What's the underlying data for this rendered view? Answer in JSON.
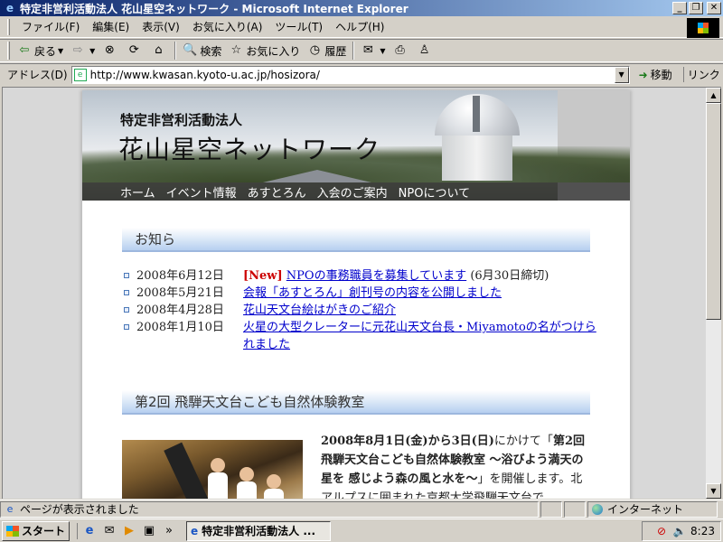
{
  "window": {
    "title": "特定非営利活動法人 花山星空ネットワーク - Microsoft Internet Explorer",
    "minimize_icon": "minimize-icon",
    "restore_icon": "restore-icon",
    "close_icon": "close-icon"
  },
  "menu": [
    "ファイル(F)",
    "編集(E)",
    "表示(V)",
    "お気に入り(A)",
    "ツール(T)",
    "ヘルプ(H)"
  ],
  "toolbar": {
    "back": "戻る",
    "search": "検索",
    "favorites": "お気に入り",
    "history": "履歴"
  },
  "address": {
    "label": "アドレス(D)",
    "url": "http://www.kwasan.kyoto-u.ac.jp/hosizora/",
    "go": "移動",
    "links": "リンク"
  },
  "site": {
    "org_type": "特定非営利活動法人",
    "org_name": "花山星空ネットワーク",
    "nav": [
      "ホーム",
      "イベント情報",
      "あすとろん",
      "入会のご案内",
      "NPOについて"
    ]
  },
  "news": {
    "heading": "お知ら",
    "items": [
      {
        "date": "2008年6月12日",
        "tag": "[New]",
        "text": "NPOの事務職員を募集しています",
        "note": " (6月30日締切)"
      },
      {
        "date": "2008年5月21日",
        "tag": "",
        "text": "会報「あすとろん」創刊号の内容を公開しました",
        "note": ""
      },
      {
        "date": "2008年4月28日",
        "tag": "",
        "text": "花山天文台絵はがきのご紹介",
        "note": ""
      },
      {
        "date": "2008年1月10日",
        "tag": "",
        "text": "火星の大型クレーターに元花山天文台長・Miyamotoの名がつけられました",
        "note": ""
      }
    ]
  },
  "event": {
    "heading": "第2回 飛騨天文台こども自然体験教室",
    "bold_intro": "2008年8月1日(金)から3日(日)",
    "text1": "にかけて「",
    "bold_title": "第2回飛騨天文台こども自然体験教室 ～浴びよう満天の星を 感じよう森の風と水を～",
    "text2": "」を開催します。北アルプスに囲まれた京都大学飛騨天文台で"
  },
  "status": {
    "message": "ページが表示されました",
    "zone": "インターネット"
  },
  "taskbar": {
    "start": "スタート",
    "task": "特定非営利活動法人 ...",
    "clock": "8:23"
  }
}
